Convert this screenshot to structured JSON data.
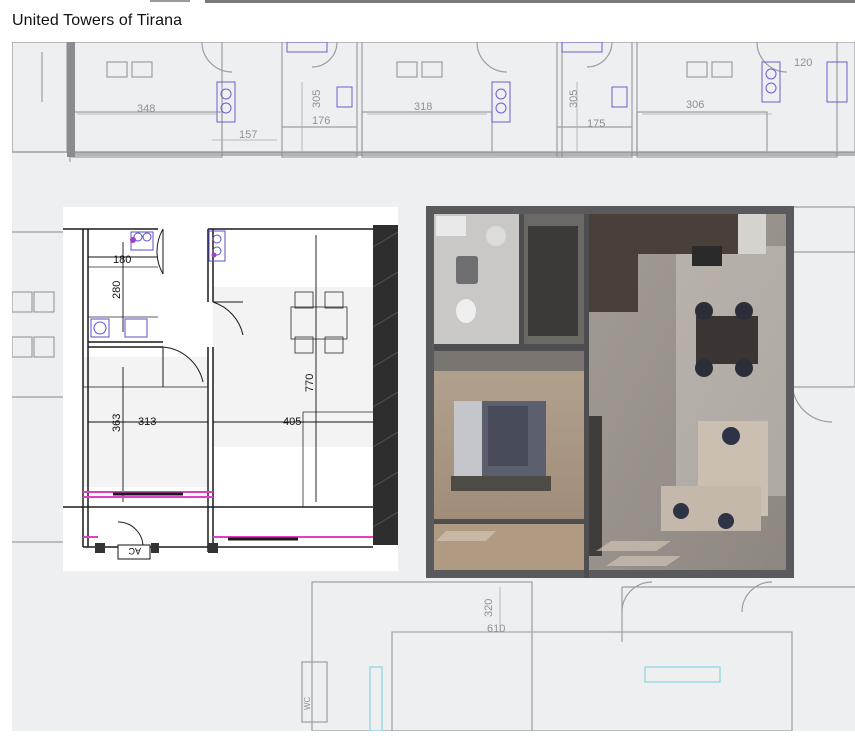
{
  "header": {
    "title": "United  Towers of Tirana"
  },
  "background_plan": {
    "dimensions": [
      "348",
      "157",
      "305",
      "176",
      "318",
      "305",
      "175",
      "306",
      "120",
      "320",
      "610"
    ],
    "wc_label": "WC"
  },
  "floor_plan": {
    "dimensions": [
      "180",
      "280",
      "363",
      "313",
      "405",
      "770"
    ],
    "ac_label": "AC"
  },
  "colors": {
    "plan_background": "#eeeff1",
    "wall_dark": "#3a3a3a",
    "window_magenta": "#e040c8",
    "render_frame": "#5a5a5c",
    "render_floor": "#9a9490"
  }
}
